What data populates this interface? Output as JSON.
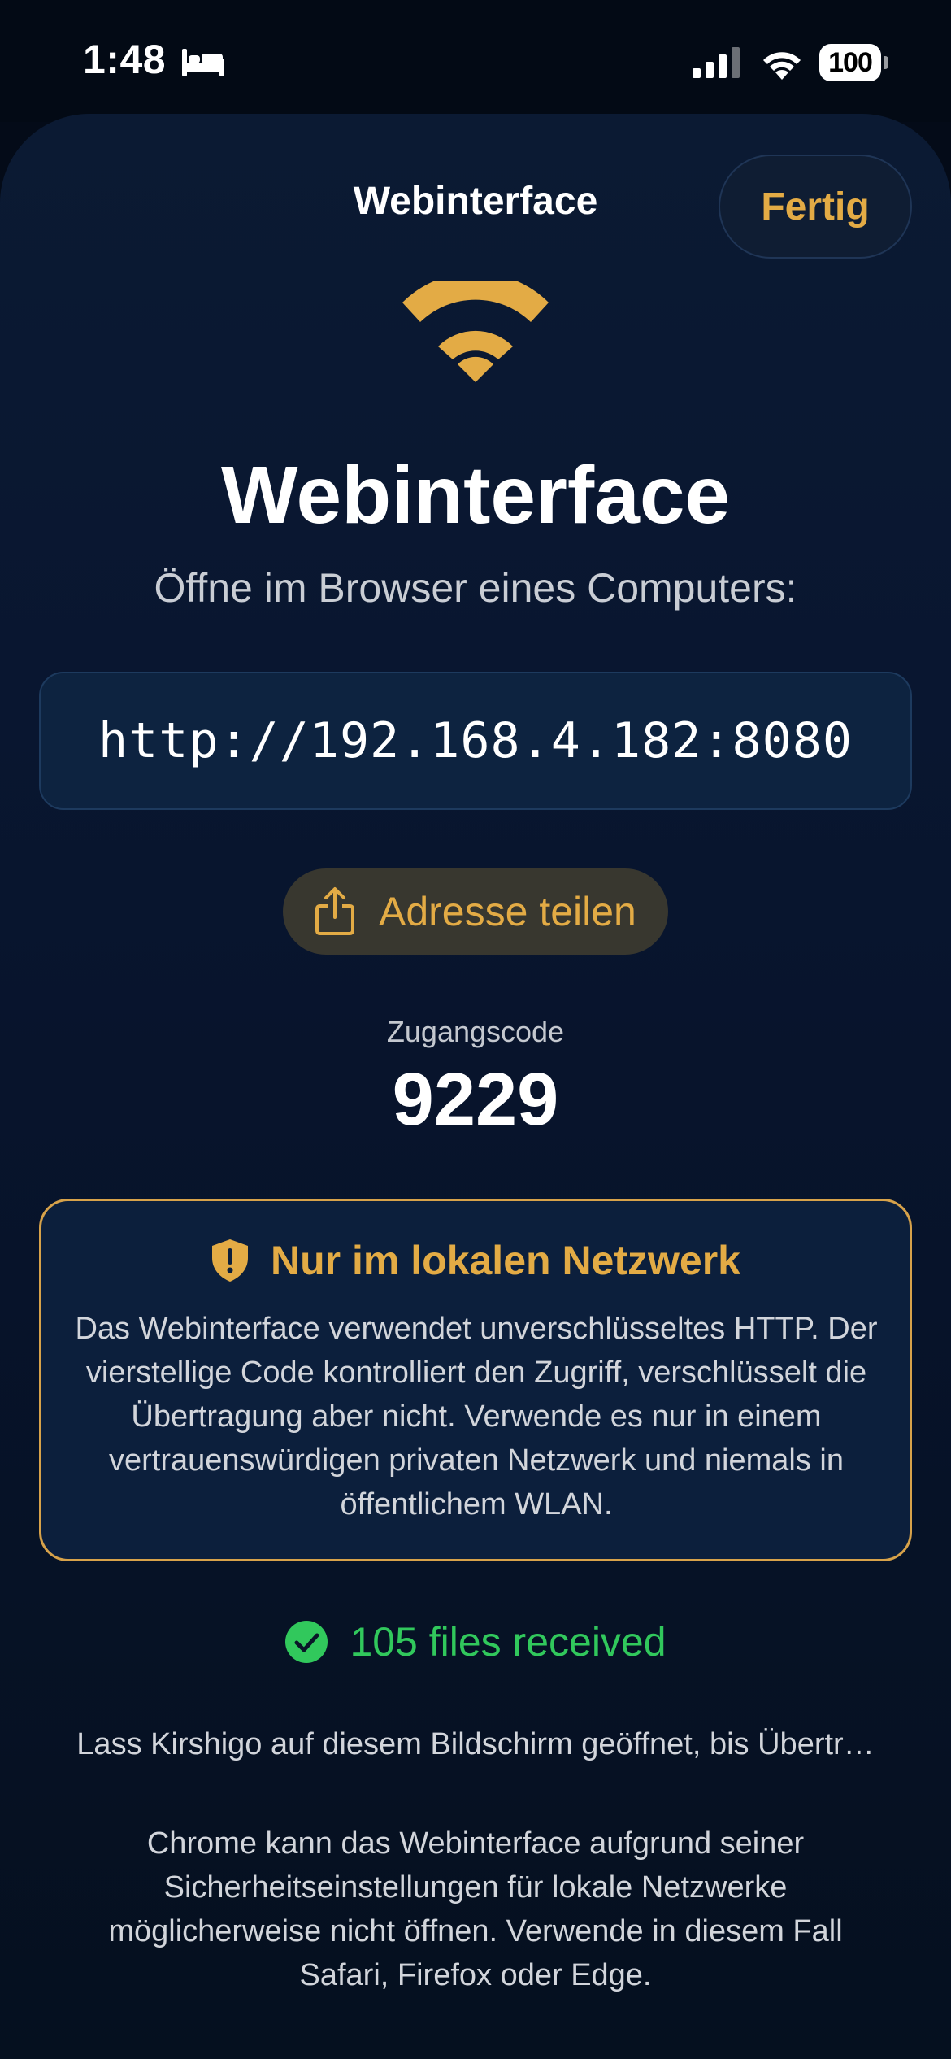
{
  "status_bar": {
    "time": "1:48",
    "battery": "100",
    "icons": [
      "sleep-icon",
      "cellular-signal-icon",
      "wifi-icon",
      "battery-icon"
    ]
  },
  "nav": {
    "title": "Webinterface",
    "done_label": "Fertig"
  },
  "hero": {
    "icon": "wifi-icon",
    "title": "Webinterface",
    "subtitle": "Öffne im Browser eines Computers:"
  },
  "url": "http://192.168.4.182:8080",
  "share": {
    "icon": "share-icon",
    "label": "Adresse teilen"
  },
  "access_code": {
    "label": "Zugangscode",
    "value": "9229"
  },
  "warning": {
    "icon": "shield-exclamation-icon",
    "title": "Nur im lokalen Netzwerk",
    "body": "Das Webinterface verwendet unverschlüsseltes HTTP. Der vierstellige Code kontrolliert den Zugriff, verschlüsselt die Übertragung aber nicht. Verwende es nur in einem vertrauenswürdigen privaten Netzwerk und niemals in öffentlichem WLAN."
  },
  "status": {
    "icon": "checkmark-circle-icon",
    "text": "105 files received"
  },
  "keep_open_text": "Lass Kirshigo auf diesem Bildschirm geöffnet, bis Übertr…",
  "chrome_note": "Chrome kann das Webinterface aufgrund seiner Sicherheitseinstellungen für lokale Netzwerke möglicherweise nicht öffnen. Verwende in diesem Fall Safari, Firefox oder Edge.",
  "colors": {
    "background": "#040b18",
    "accent": "#e3ab45",
    "success": "#31c85c",
    "card": "#0d2340"
  }
}
